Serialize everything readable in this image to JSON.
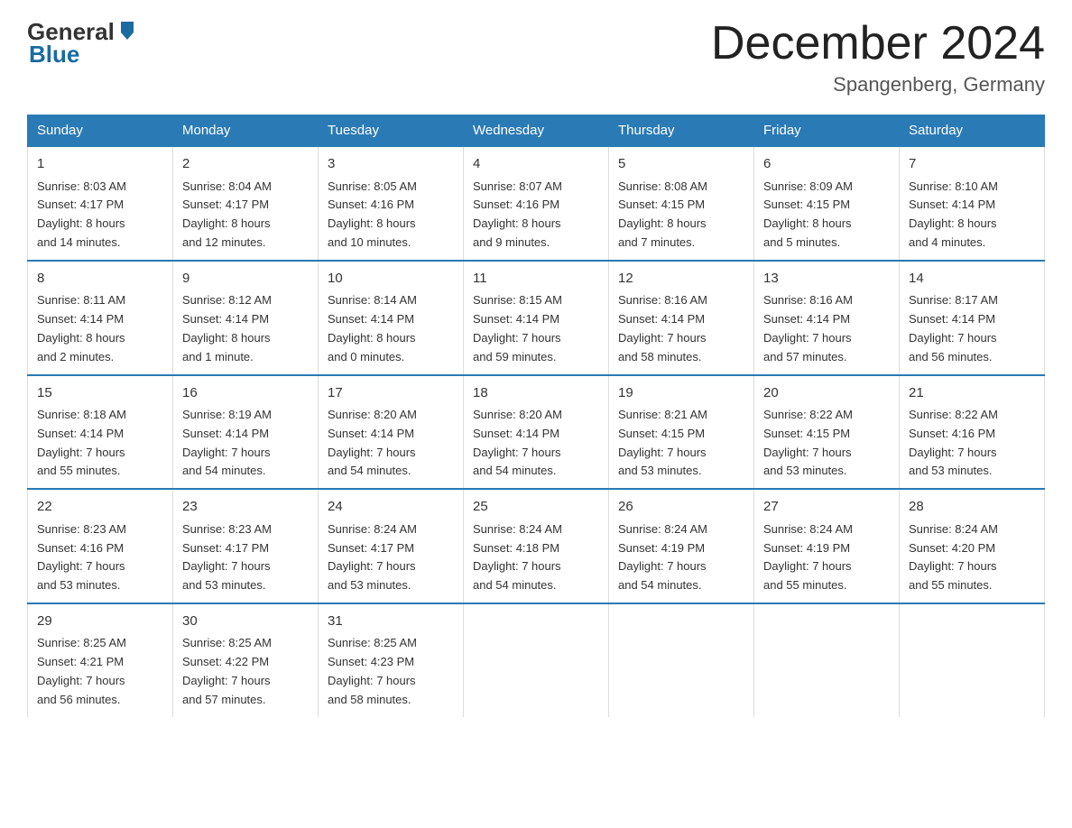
{
  "header": {
    "logo_text_general": "General",
    "logo_text_blue": "Blue",
    "month_title": "December 2024",
    "location": "Spangenberg, Germany"
  },
  "days_of_week": [
    "Sunday",
    "Monday",
    "Tuesday",
    "Wednesday",
    "Thursday",
    "Friday",
    "Saturday"
  ],
  "weeks": [
    [
      {
        "day": "1",
        "sunrise": "8:03 AM",
        "sunset": "4:17 PM",
        "daylight": "8 hours and 14 minutes."
      },
      {
        "day": "2",
        "sunrise": "8:04 AM",
        "sunset": "4:17 PM",
        "daylight": "8 hours and 12 minutes."
      },
      {
        "day": "3",
        "sunrise": "8:05 AM",
        "sunset": "4:16 PM",
        "daylight": "8 hours and 10 minutes."
      },
      {
        "day": "4",
        "sunrise": "8:07 AM",
        "sunset": "4:16 PM",
        "daylight": "8 hours and 9 minutes."
      },
      {
        "day": "5",
        "sunrise": "8:08 AM",
        "sunset": "4:15 PM",
        "daylight": "8 hours and 7 minutes."
      },
      {
        "day": "6",
        "sunrise": "8:09 AM",
        "sunset": "4:15 PM",
        "daylight": "8 hours and 5 minutes."
      },
      {
        "day": "7",
        "sunrise": "8:10 AM",
        "sunset": "4:14 PM",
        "daylight": "8 hours and 4 minutes."
      }
    ],
    [
      {
        "day": "8",
        "sunrise": "8:11 AM",
        "sunset": "4:14 PM",
        "daylight": "8 hours and 2 minutes."
      },
      {
        "day": "9",
        "sunrise": "8:12 AM",
        "sunset": "4:14 PM",
        "daylight": "8 hours and 1 minute."
      },
      {
        "day": "10",
        "sunrise": "8:14 AM",
        "sunset": "4:14 PM",
        "daylight": "8 hours and 0 minutes."
      },
      {
        "day": "11",
        "sunrise": "8:15 AM",
        "sunset": "4:14 PM",
        "daylight": "7 hours and 59 minutes."
      },
      {
        "day": "12",
        "sunrise": "8:16 AM",
        "sunset": "4:14 PM",
        "daylight": "7 hours and 58 minutes."
      },
      {
        "day": "13",
        "sunrise": "8:16 AM",
        "sunset": "4:14 PM",
        "daylight": "7 hours and 57 minutes."
      },
      {
        "day": "14",
        "sunrise": "8:17 AM",
        "sunset": "4:14 PM",
        "daylight": "7 hours and 56 minutes."
      }
    ],
    [
      {
        "day": "15",
        "sunrise": "8:18 AM",
        "sunset": "4:14 PM",
        "daylight": "7 hours and 55 minutes."
      },
      {
        "day": "16",
        "sunrise": "8:19 AM",
        "sunset": "4:14 PM",
        "daylight": "7 hours and 54 minutes."
      },
      {
        "day": "17",
        "sunrise": "8:20 AM",
        "sunset": "4:14 PM",
        "daylight": "7 hours and 54 minutes."
      },
      {
        "day": "18",
        "sunrise": "8:20 AM",
        "sunset": "4:14 PM",
        "daylight": "7 hours and 54 minutes."
      },
      {
        "day": "19",
        "sunrise": "8:21 AM",
        "sunset": "4:15 PM",
        "daylight": "7 hours and 53 minutes."
      },
      {
        "day": "20",
        "sunrise": "8:22 AM",
        "sunset": "4:15 PM",
        "daylight": "7 hours and 53 minutes."
      },
      {
        "day": "21",
        "sunrise": "8:22 AM",
        "sunset": "4:16 PM",
        "daylight": "7 hours and 53 minutes."
      }
    ],
    [
      {
        "day": "22",
        "sunrise": "8:23 AM",
        "sunset": "4:16 PM",
        "daylight": "7 hours and 53 minutes."
      },
      {
        "day": "23",
        "sunrise": "8:23 AM",
        "sunset": "4:17 PM",
        "daylight": "7 hours and 53 minutes."
      },
      {
        "day": "24",
        "sunrise": "8:24 AM",
        "sunset": "4:17 PM",
        "daylight": "7 hours and 53 minutes."
      },
      {
        "day": "25",
        "sunrise": "8:24 AM",
        "sunset": "4:18 PM",
        "daylight": "7 hours and 54 minutes."
      },
      {
        "day": "26",
        "sunrise": "8:24 AM",
        "sunset": "4:19 PM",
        "daylight": "7 hours and 54 minutes."
      },
      {
        "day": "27",
        "sunrise": "8:24 AM",
        "sunset": "4:19 PM",
        "daylight": "7 hours and 55 minutes."
      },
      {
        "day": "28",
        "sunrise": "8:24 AM",
        "sunset": "4:20 PM",
        "daylight": "7 hours and 55 minutes."
      }
    ],
    [
      {
        "day": "29",
        "sunrise": "8:25 AM",
        "sunset": "4:21 PM",
        "daylight": "7 hours and 56 minutes."
      },
      {
        "day": "30",
        "sunrise": "8:25 AM",
        "sunset": "4:22 PM",
        "daylight": "7 hours and 57 minutes."
      },
      {
        "day": "31",
        "sunrise": "8:25 AM",
        "sunset": "4:23 PM",
        "daylight": "7 hours and 58 minutes."
      },
      null,
      null,
      null,
      null
    ]
  ],
  "labels": {
    "sunrise": "Sunrise:",
    "sunset": "Sunset:",
    "daylight": "Daylight:"
  }
}
